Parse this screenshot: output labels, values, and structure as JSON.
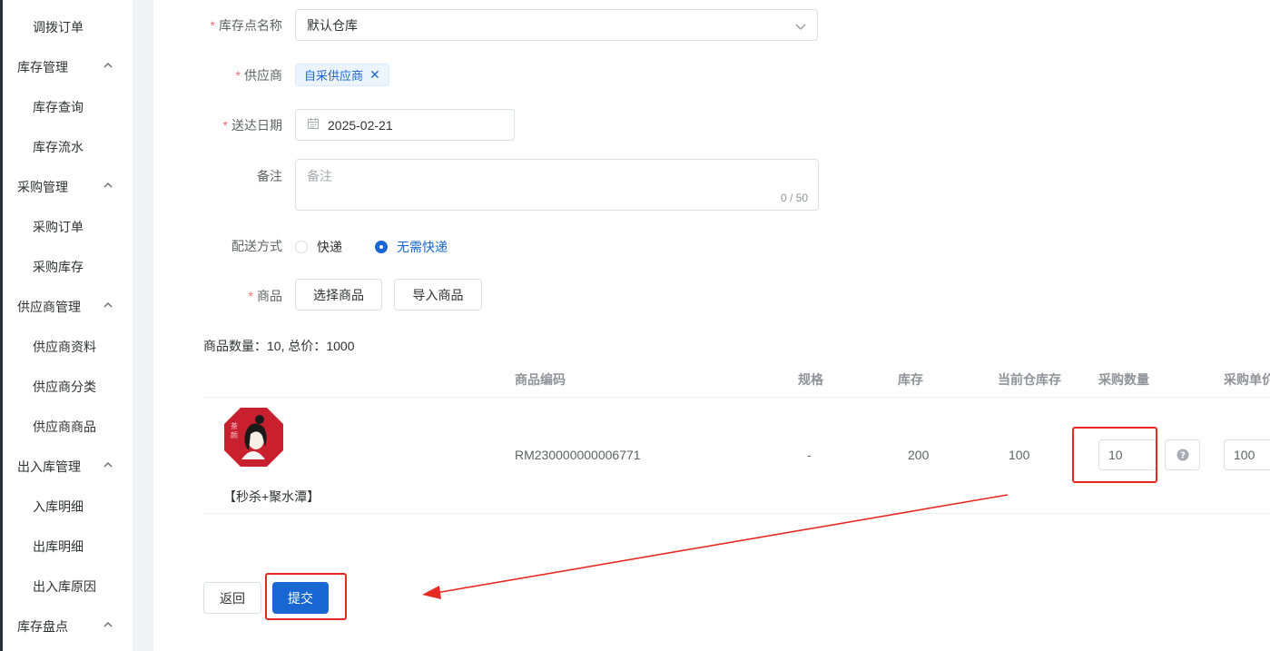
{
  "sidebar": {
    "items": [
      {
        "label": "调拨订单",
        "kind": "sub"
      },
      {
        "label": "库存管理",
        "kind": "group"
      },
      {
        "label": "库存查询",
        "kind": "sub"
      },
      {
        "label": "库存流水",
        "kind": "sub"
      },
      {
        "label": "采购管理",
        "kind": "group"
      },
      {
        "label": "采购订单",
        "kind": "sub"
      },
      {
        "label": "采购库存",
        "kind": "sub"
      },
      {
        "label": "供应商管理",
        "kind": "group"
      },
      {
        "label": "供应商资料",
        "kind": "sub"
      },
      {
        "label": "供应商分类",
        "kind": "sub"
      },
      {
        "label": "供应商商品",
        "kind": "sub"
      },
      {
        "label": "出入库管理",
        "kind": "group"
      },
      {
        "label": "入库明细",
        "kind": "sub"
      },
      {
        "label": "出库明细",
        "kind": "sub"
      },
      {
        "label": "出入库原因",
        "kind": "sub"
      },
      {
        "label": "库存盘点",
        "kind": "group"
      }
    ]
  },
  "form": {
    "required_mark": "*",
    "warehouse_label": "库存点名称",
    "warehouse_value": "默认仓库",
    "supplier_label": "供应商",
    "supplier_tag": "自采供应商",
    "date_label": "送达日期",
    "date_value": "2025-02-21",
    "remark_label": "备注",
    "remark_placeholder": "备注",
    "remark_count": "0 / 50",
    "delivery_label": "配送方式",
    "delivery_options": [
      "快递",
      "无需快递"
    ],
    "delivery_selected": "无需快递",
    "goods_label": "商品",
    "select_goods_button": "选择商品",
    "import_goods_button": "导入商品"
  },
  "summary": "商品数量：10, 总价：1000",
  "table": {
    "headers": [
      "商品编码",
      "规格",
      "库存",
      "当前仓库存",
      "采购数量",
      "采购单价"
    ],
    "rows": [
      {
        "name": "【秒杀+聚水潭】",
        "code": "RM230000000006771",
        "spec": "-",
        "stock": "200",
        "warehouse_stock": "100",
        "qty": "10",
        "price": "100"
      }
    ]
  },
  "actions": {
    "back": "返回",
    "submit": "提交"
  },
  "colors": {
    "primary": "#1967d2",
    "annotation": "#e62a22",
    "required": "#f56c6c"
  },
  "icons": [
    "chevron-up-icon",
    "chevron-down-icon",
    "calendar-icon",
    "close-icon",
    "question-icon",
    "product-logo-image"
  ]
}
